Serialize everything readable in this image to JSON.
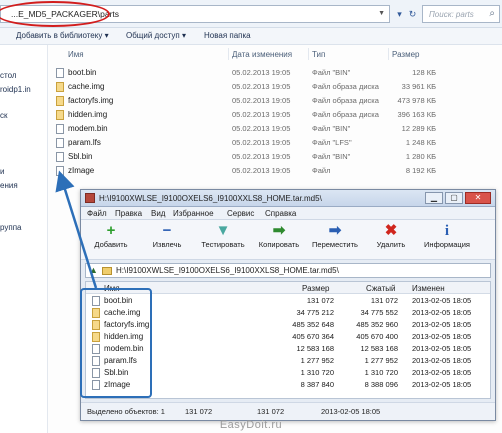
{
  "explorer": {
    "address": "...E_MD5_PACKAGER\\parts",
    "search_placeholder": "Поиск: parts",
    "toolbar": {
      "add_to_library": "Добавить в библиотеку ▾",
      "share": "Общий доступ ▾",
      "new_folder": "Новая папка"
    },
    "nav_items": [
      "стол",
      "roidp1.in",
      "ск",
      "",
      "и",
      "ения",
      "",
      "руппа"
    ],
    "columns": {
      "name": "Имя",
      "date": "Дата изменения",
      "type": "Тип",
      "size": "Размер"
    },
    "files": [
      {
        "name": "boot.bin",
        "date": "05.02.2013 19:05",
        "type": "Файл \"BIN\"",
        "size": "128 КБ",
        "icon": "file-icon"
      },
      {
        "name": "cache.img",
        "date": "05.02.2013 19:05",
        "type": "Файл образа диска",
        "size": "33 961 КБ",
        "icon": "disk-image-icon"
      },
      {
        "name": "factoryfs.img",
        "date": "05.02.2013 19:05",
        "type": "Файл образа диска",
        "size": "473 978 КБ",
        "icon": "disk-image-icon"
      },
      {
        "name": "hidden.img",
        "date": "05.02.2013 19:05",
        "type": "Файл образа диска",
        "size": "396 163 КБ",
        "icon": "disk-image-icon"
      },
      {
        "name": "modem.bin",
        "date": "05.02.2013 19:05",
        "type": "Файл \"BIN\"",
        "size": "12 289 КБ",
        "icon": "file-icon"
      },
      {
        "name": "param.lfs",
        "date": "05.02.2013 19:05",
        "type": "Файл \"LFS\"",
        "size": "1 248 КБ",
        "icon": "file-icon"
      },
      {
        "name": "Sbl.bin",
        "date": "05.02.2013 19:05",
        "type": "Файл \"BIN\"",
        "size": "1 280 КБ",
        "icon": "file-icon"
      },
      {
        "name": "zImage",
        "date": "05.02.2013 19:05",
        "type": "Файл",
        "size": "8 192 КБ",
        "icon": "file-icon"
      }
    ]
  },
  "archiver": {
    "title": "H:\\I9100XWLSE_I9100OXELS6_I9100XXLS8_HOME.tar.md5\\",
    "menu": [
      "Файл",
      "Правка",
      "Вид",
      "Избранное",
      "Сервис",
      "Справка"
    ],
    "tools": [
      {
        "label": "Добавить",
        "glyph": "+",
        "color": "#2e9e2e",
        "icon": "add-icon"
      },
      {
        "label": "Извлечь",
        "glyph": "−",
        "color": "#2b5fb3",
        "icon": "extract-icon"
      },
      {
        "label": "Тестировать",
        "glyph": "▼",
        "color": "#4aa8a0",
        "icon": "test-icon"
      },
      {
        "label": "Копировать",
        "glyph": "➡",
        "color": "#2f8a2f",
        "icon": "copy-icon"
      },
      {
        "label": "Переместить",
        "glyph": "➡",
        "color": "#2b5fb3",
        "icon": "move-icon"
      },
      {
        "label": "Удалить",
        "glyph": "✖",
        "color": "#d0261d",
        "icon": "delete-icon"
      },
      {
        "label": "Информация",
        "glyph": "i",
        "color": "#2b5fb3",
        "icon": "info-icon"
      }
    ],
    "path": "H:\\I9100XWLSE_I9100OXELS6_I9100XXLS8_HOME.tar.md5\\",
    "columns": {
      "name": "Имя",
      "size": "Размер",
      "packed": "Сжатый",
      "modified": "Изменен"
    },
    "files": [
      {
        "name": "boot.bin",
        "size": "131 072",
        "packed": "131 072",
        "modified": "2013-02-05 18:05",
        "icon": "file-icon"
      },
      {
        "name": "cache.img",
        "size": "34 775 212",
        "packed": "34 775 552",
        "modified": "2013-02-05 18:05",
        "icon": "disk-image-icon"
      },
      {
        "name": "factoryfs.img",
        "size": "485 352 648",
        "packed": "485 352 960",
        "modified": "2013-02-05 18:05",
        "icon": "disk-image-icon"
      },
      {
        "name": "hidden.img",
        "size": "405 670 364",
        "packed": "405 670 400",
        "modified": "2013-02-05 18:05",
        "icon": "disk-image-icon"
      },
      {
        "name": "modem.bin",
        "size": "12 583 168",
        "packed": "12 583 168",
        "modified": "2013-02-05 18:05",
        "icon": "file-icon"
      },
      {
        "name": "param.lfs",
        "size": "1 277 952",
        "packed": "1 277 952",
        "modified": "2013-02-05 18:05",
        "icon": "file-icon"
      },
      {
        "name": "Sbl.bin",
        "size": "1 310 720",
        "packed": "1 310 720",
        "modified": "2013-02-05 18:05",
        "icon": "file-icon"
      },
      {
        "name": "zImage",
        "size": "8 387 840",
        "packed": "8 388 096",
        "modified": "2013-02-05 18:05",
        "icon": "file-icon"
      }
    ],
    "status": {
      "selected": "Выделено объектов: 1",
      "size": "131 072",
      "packed": "131 072",
      "modified": "2013-02-05 18:05"
    }
  },
  "watermark": "EasyDoit.ru",
  "colors": {
    "highlight_red": "#d21d1d",
    "annotation_blue": "#2d6fb8"
  }
}
